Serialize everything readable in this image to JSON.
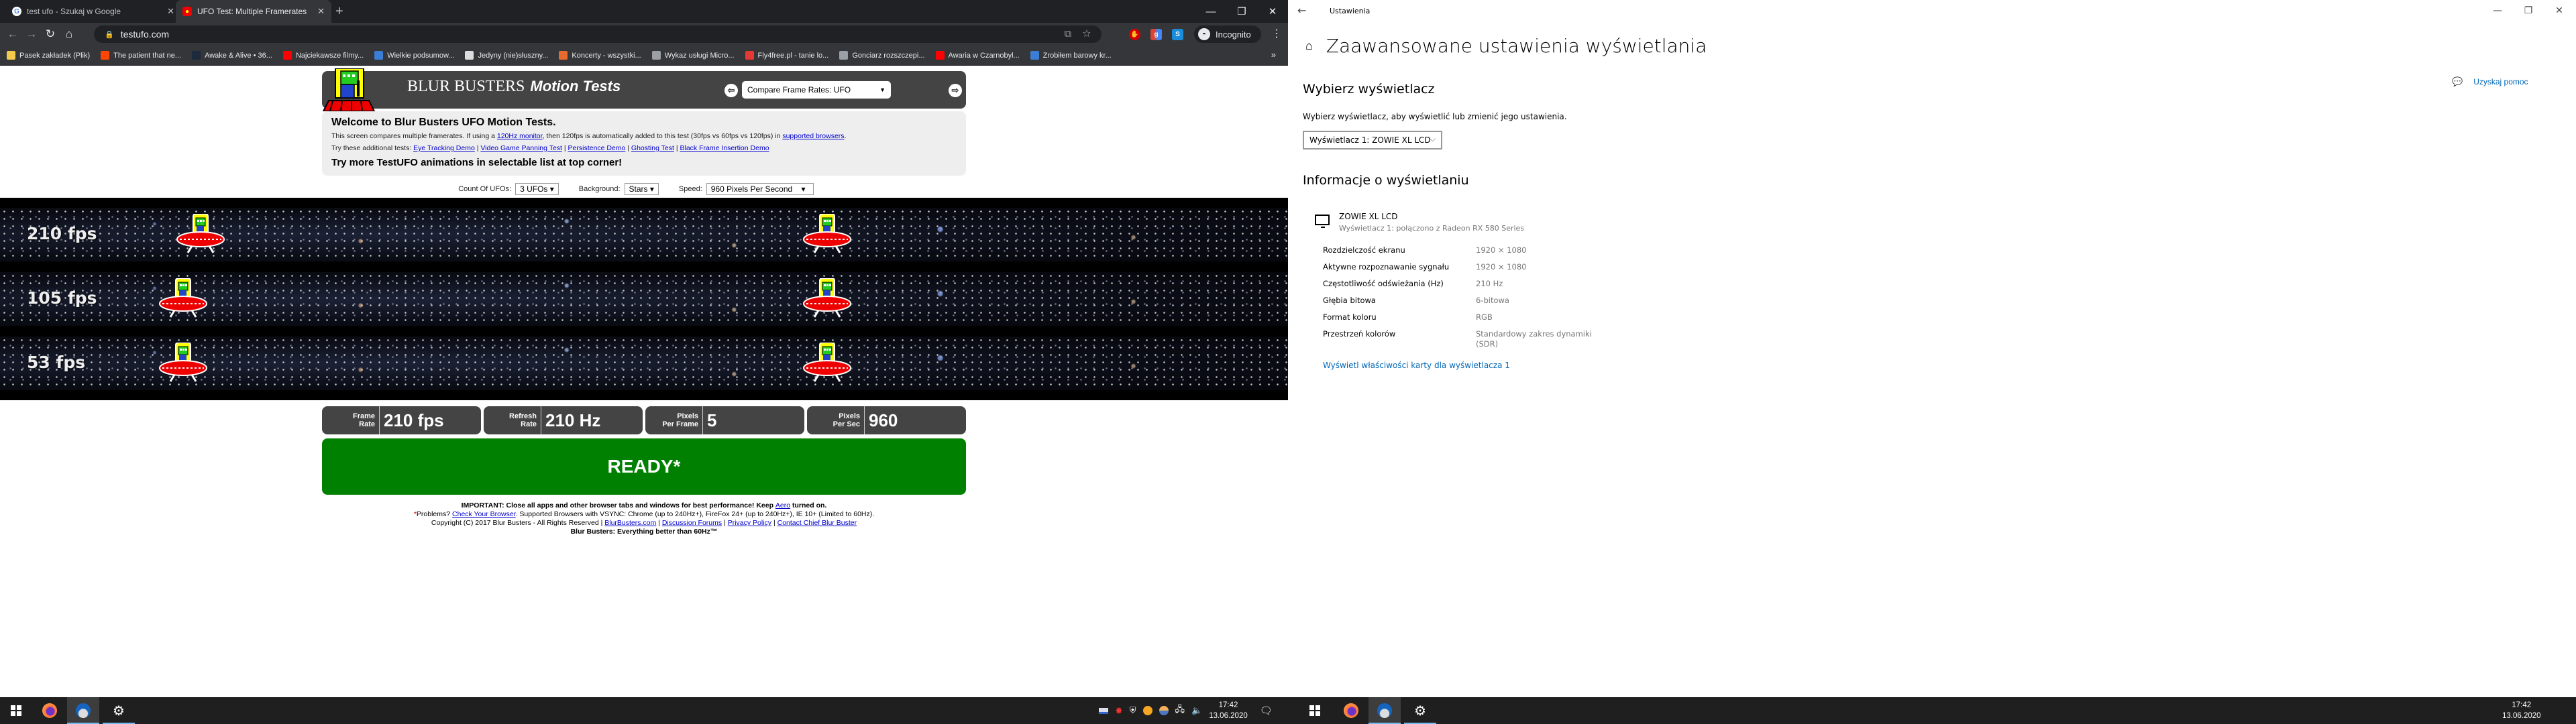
{
  "browser": {
    "tabs": [
      {
        "title": "test ufo - Szukaj w Google",
        "icon": "google-icon",
        "active": false
      },
      {
        "title": "UFO Test: Multiple Framerates",
        "icon": "ufo-icon",
        "active": true
      }
    ],
    "new_tab": "+",
    "close_glyph": "✕",
    "window_controls": {
      "minimize": "—",
      "maximize": "❐",
      "close": "✕"
    },
    "nav": {
      "back": "←",
      "forward": "→",
      "reload": "↻",
      "home": "⌂"
    },
    "url": "testufo.com",
    "profile": "Incognito",
    "bookmarks": [
      {
        "label": "Pasek zakładek (Plik)",
        "icon": "folder-icon",
        "color": "#f2c94c"
      },
      {
        "label": "The patient that ne...",
        "icon": "reddit-icon",
        "color": "#ff4500"
      },
      {
        "label": "Awake & Alive • 36...",
        "icon": "tumblr-icon",
        "color": "#1b2a3d"
      },
      {
        "label": "Najciekawsze filmy...",
        "icon": "youtube-icon",
        "color": "#ff0000"
      },
      {
        "label": "Wielkie podsumow...",
        "icon": "wykop-icon",
        "color": "#3c7ed4"
      },
      {
        "label": "Jedyny (nie)słuszny...",
        "icon": "site-icon",
        "color": "#dddddd"
      },
      {
        "label": "Koncerty - wszystki...",
        "icon": "site-icon",
        "color": "#e86a2c"
      },
      {
        "label": "Wykaz usługi Micro...",
        "icon": "globe-icon",
        "color": "#9aa0a6"
      },
      {
        "label": "Fly4free.pl - tanie lo...",
        "icon": "fly4free-icon",
        "color": "#e53935"
      },
      {
        "label": "Gonciarz rozszczepi...",
        "icon": "globe-icon",
        "color": "#9aa0a6"
      },
      {
        "label": "Awaria w Czarnobyl...",
        "icon": "youtube-icon",
        "color": "#ff0000"
      },
      {
        "label": "Zrobiłem barowy kr...",
        "icon": "wykop-icon",
        "color": "#3c7ed4"
      }
    ],
    "bookmarks_more": "»"
  },
  "testufo": {
    "brand": "BLUR  BUSTERS",
    "brand_italic": "Motion Tests",
    "test_select": "Compare Frame Rates: UFO",
    "welcome_title": "Welcome to Blur Busters UFO Motion Tests.",
    "intro_a": "This screen compares multiple framerates. If using a ",
    "intro_link1": "120Hz monitor",
    "intro_b": ", then 120fps is automatically added to this test (30fps vs 60fps vs 120fps) in ",
    "intro_link2": "supported browsers",
    "intro_c": ".",
    "try_label": "Try these additional tests: ",
    "try_links": [
      "Eye Tracking Demo",
      "Video Game Panning Test",
      "Persistence Demo",
      "Ghosting Test",
      "Black Frame Insertion Demo"
    ],
    "more_title": "Try more TestUFO animations in selectable list at top corner!",
    "controls": {
      "count_label": "Count Of UFOs:",
      "count_value": "3 UFOs",
      "background_label": "Background:",
      "background_value": "Stars",
      "speed_label": "Speed:",
      "speed_value": "960 Pixels Per Second"
    },
    "lanes": [
      {
        "fps": "210 fps"
      },
      {
        "fps": "105 fps"
      },
      {
        "fps": "53 fps"
      }
    ],
    "stats": [
      {
        "label1": "Frame",
        "label2": "Rate",
        "value": "210 fps"
      },
      {
        "label1": "Refresh",
        "label2": "Rate",
        "value": "210 Hz"
      },
      {
        "label1": "Pixels",
        "label2": "Per Frame",
        "value": "5"
      },
      {
        "label1": "Pixels",
        "label2": "Per Sec",
        "value": "960"
      }
    ],
    "status": "READY*",
    "footer": {
      "important_a": "IMPORTANT: Close all apps and other browser tabs and windows for best performance! Keep ",
      "important_link": "Aero",
      "important_b": " turned on.",
      "star": "*",
      "problems_a": "Problems? ",
      "problems_link": "Check Your Browser",
      "problems_b": ". Supported Browsers with VSYNC: Chrome (up to 240Hz+), FireFox 24+ (up to 240Hz+), IE 10+ (Limited to 60Hz).",
      "copyright": "Copyright (C) 2017 Blur Busters - All Rights Reserved | ",
      "links": [
        "BlurBusters.com",
        "Discussion Forums",
        "Privacy Policy",
        "Contact Chief Blur Buster"
      ],
      "tagline": "Blur Busters: Everything better than 60Hz™"
    }
  },
  "settings": {
    "window_title": "Ustawienia",
    "back": "←",
    "window_controls": {
      "minimize": "—",
      "maximize": "❐",
      "close": "✕"
    },
    "page_title": "Zaawansowane ustawienia wyświetlania",
    "home_glyph": "⌂",
    "choose_heading": "Wybierz wyświetlacz",
    "choose_desc": "Wybierz wyświetlacz, aby wyświetlić lub zmienić jego ustawienia.",
    "display_select": "Wyświetlacz 1: ZOWIE XL LCD",
    "chevron": "⌵",
    "info_heading": "Informacje o wyświetlaniu",
    "monitor_name": "ZOWIE XL LCD",
    "monitor_sub": "Wyświetlacz 1: połączono z Radeon RX 580 Series",
    "rows": [
      {
        "key": "Rozdzielczość ekranu",
        "value": "1920 × 1080"
      },
      {
        "key": "Aktywne rozpoznawanie sygnału",
        "value": "1920 × 1080"
      },
      {
        "key": "Częstotliwość odświeżania (Hz)",
        "value": "210 Hz"
      },
      {
        "key": "Głębia bitowa",
        "value": "6-bitowa"
      },
      {
        "key": "Format koloru",
        "value": "RGB"
      },
      {
        "key": "Przestrzeń kolorów",
        "value": "Standardowy zakres dynamiki (SDR)"
      }
    ],
    "adapter_link": "Wyświetl właściwości karty dla wyświetlacza 1",
    "help": "Uzyskaj pomoc"
  },
  "taskbar": {
    "time": "17:42",
    "date": "13.06.2020"
  }
}
